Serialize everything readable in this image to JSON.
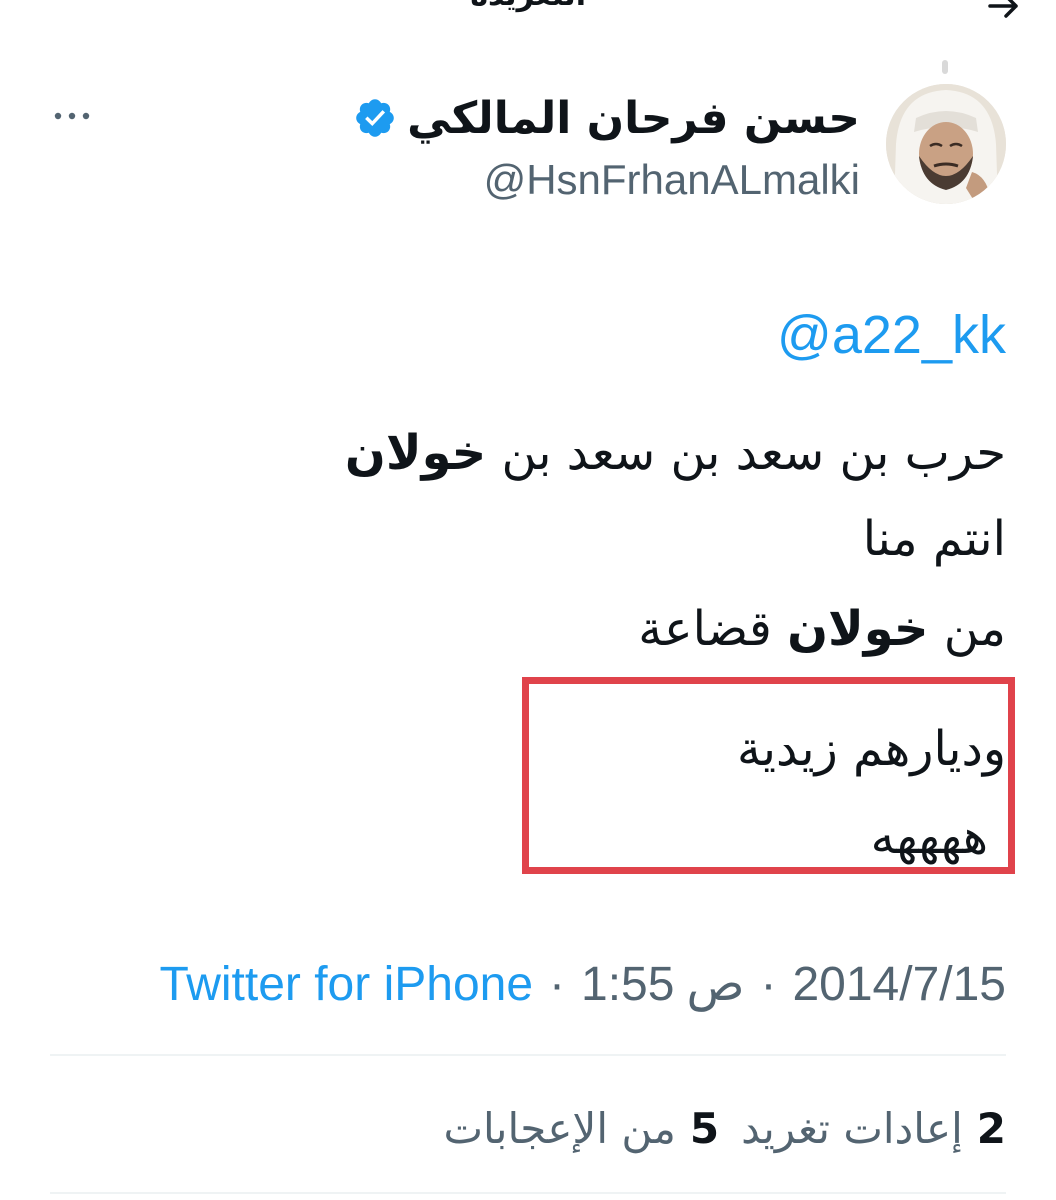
{
  "header": {
    "title": "التغريدة"
  },
  "author": {
    "display_name": "حسن فرحان المالكي",
    "handle": "@HsnFrhanALmalki",
    "verified": true
  },
  "tweet": {
    "mention": "@a22_kk",
    "line1_prefix": "حرب بن سعد بن سعد بن ",
    "line1_bold": "خولان",
    "line2": "انتم منا",
    "line3_prefix": "من ",
    "line3_bold": "خولان",
    "line3_suffix": " قضاعة",
    "line4": "وديارهم زيدية",
    "line5": "ههههه"
  },
  "meta": {
    "date": "2014/7/15",
    "time": "1:55",
    "ampm": "ص",
    "separator": "·",
    "source": "Twitter for iPhone"
  },
  "stats": {
    "retweets_count": "2",
    "retweets_label": "إعادات تغريد",
    "likes_count": "5",
    "likes_label": "من الإعجابات"
  },
  "colors": {
    "link": "#1d9bf0",
    "secondary_text": "#536471",
    "highlight_border": "#e0434b",
    "verified_badge": "#1d9bf0"
  },
  "icons": {
    "back": "arrow-right-icon",
    "more": "more-horizontal-icon",
    "verified": "verified-badge-icon"
  }
}
